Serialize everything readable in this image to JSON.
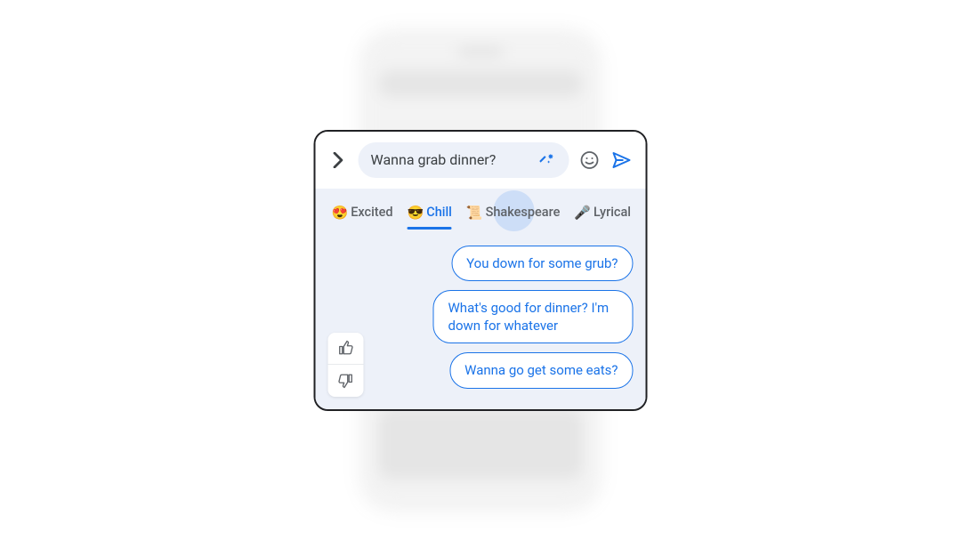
{
  "input": {
    "text": "Wanna grab dinner?"
  },
  "tabs": [
    {
      "emoji": "😍",
      "label": "Excited",
      "active": false
    },
    {
      "emoji": "😎",
      "label": "Chill",
      "active": true
    },
    {
      "emoji": "📜",
      "label": "Shakespeare",
      "active": false
    },
    {
      "emoji": "🎤",
      "label": "Lyrical",
      "active": false
    }
  ],
  "suggestions": [
    "You down for some grub?",
    "What's good for dinner? I'm down for whatever",
    "Wanna go get some eats?"
  ],
  "colors": {
    "primary": "#1a73e8",
    "surface": "#edf1f9",
    "text": "#3c4043",
    "textSecondary": "#5f6368"
  }
}
